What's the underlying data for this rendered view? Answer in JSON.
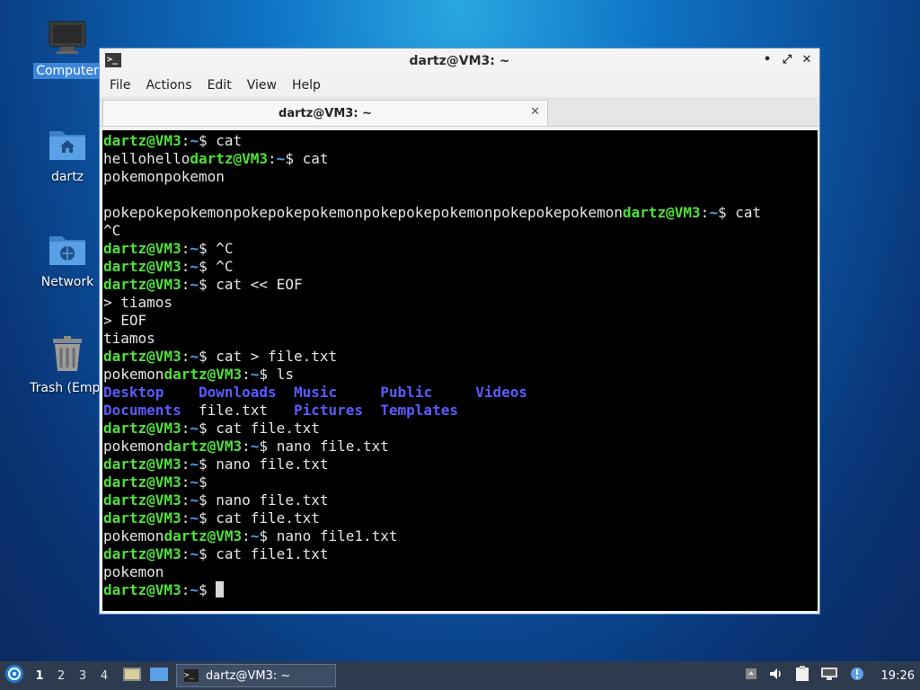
{
  "desktop": {
    "icons": [
      {
        "name": "Computer"
      },
      {
        "name": "dartz"
      },
      {
        "name": "Network"
      },
      {
        "name": "Trash (Empt"
      }
    ]
  },
  "window": {
    "title": "dartz@VM3: ~",
    "menu": [
      "File",
      "Actions",
      "Edit",
      "View",
      "Help"
    ],
    "tab_title": "dartz@VM3: ~",
    "controls": {
      "minimize": "•",
      "maximize": "⤢",
      "close": "✕"
    }
  },
  "terminal": {
    "lines": [
      [
        {
          "t": "dartz@VM3",
          "c": "user"
        },
        {
          "t": ":"
        },
        {
          "t": "~",
          "c": "path"
        },
        {
          "t": "$ cat"
        }
      ],
      [
        {
          "t": "hellohello"
        },
        {
          "t": "dartz@VM3",
          "c": "user"
        },
        {
          "t": ":"
        },
        {
          "t": "~",
          "c": "path"
        },
        {
          "t": "$ cat"
        }
      ],
      [
        {
          "t": "pokemonpokemon"
        }
      ],
      [
        {
          "t": ""
        }
      ],
      [
        {
          "t": "pokepokepokemonpokepokepokemonpokepokepokemonpokepokepokemon"
        },
        {
          "t": "dartz@VM3",
          "c": "user"
        },
        {
          "t": ":"
        },
        {
          "t": "~",
          "c": "path"
        },
        {
          "t": "$ cat"
        }
      ],
      [
        {
          "t": "^C"
        }
      ],
      [
        {
          "t": "dartz@VM3",
          "c": "user"
        },
        {
          "t": ":"
        },
        {
          "t": "~",
          "c": "path"
        },
        {
          "t": "$ ^C"
        }
      ],
      [
        {
          "t": "dartz@VM3",
          "c": "user"
        },
        {
          "t": ":"
        },
        {
          "t": "~",
          "c": "path"
        },
        {
          "t": "$ ^C"
        }
      ],
      [
        {
          "t": "dartz@VM3",
          "c": "user"
        },
        {
          "t": ":"
        },
        {
          "t": "~",
          "c": "path"
        },
        {
          "t": "$ cat << EOF"
        }
      ],
      [
        {
          "t": "> tiamos"
        }
      ],
      [
        {
          "t": "> EOF"
        }
      ],
      [
        {
          "t": "tiamos"
        }
      ],
      [
        {
          "t": "dartz@VM3",
          "c": "user"
        },
        {
          "t": ":"
        },
        {
          "t": "~",
          "c": "path"
        },
        {
          "t": "$ cat > file.txt"
        }
      ],
      [
        {
          "t": "pokemon"
        },
        {
          "t": "dartz@VM3",
          "c": "user"
        },
        {
          "t": ":"
        },
        {
          "t": "~",
          "c": "path"
        },
        {
          "t": "$ ls"
        }
      ],
      [
        {
          "t": "Desktop",
          "c": "dir"
        },
        {
          "t": "    "
        },
        {
          "t": "Downloads",
          "c": "dir"
        },
        {
          "t": "  "
        },
        {
          "t": "Music",
          "c": "dir"
        },
        {
          "t": "     "
        },
        {
          "t": "Public",
          "c": "dir"
        },
        {
          "t": "     "
        },
        {
          "t": "Videos",
          "c": "dir"
        }
      ],
      [
        {
          "t": "Documents",
          "c": "dir"
        },
        {
          "t": "  file.txt   "
        },
        {
          "t": "Pictures",
          "c": "dir"
        },
        {
          "t": "  "
        },
        {
          "t": "Templates",
          "c": "dir"
        }
      ],
      [
        {
          "t": "dartz@VM3",
          "c": "user"
        },
        {
          "t": ":"
        },
        {
          "t": "~",
          "c": "path"
        },
        {
          "t": "$ cat file.txt"
        }
      ],
      [
        {
          "t": "pokemon"
        },
        {
          "t": "dartz@VM3",
          "c": "user"
        },
        {
          "t": ":"
        },
        {
          "t": "~",
          "c": "path"
        },
        {
          "t": "$ nano file.txt"
        }
      ],
      [
        {
          "t": "dartz@VM3",
          "c": "user"
        },
        {
          "t": ":"
        },
        {
          "t": "~",
          "c": "path"
        },
        {
          "t": "$ nano file.txt"
        }
      ],
      [
        {
          "t": "dartz@VM3",
          "c": "user"
        },
        {
          "t": ":"
        },
        {
          "t": "~",
          "c": "path"
        },
        {
          "t": "$"
        }
      ],
      [
        {
          "t": "dartz@VM3",
          "c": "user"
        },
        {
          "t": ":"
        },
        {
          "t": "~",
          "c": "path"
        },
        {
          "t": "$ nano file.txt"
        }
      ],
      [
        {
          "t": "dartz@VM3",
          "c": "user"
        },
        {
          "t": ":"
        },
        {
          "t": "~",
          "c": "path"
        },
        {
          "t": "$ cat file.txt"
        }
      ],
      [
        {
          "t": "pokemon"
        },
        {
          "t": "dartz@VM3",
          "c": "user"
        },
        {
          "t": ":"
        },
        {
          "t": "~",
          "c": "path"
        },
        {
          "t": "$ nano file1.txt"
        }
      ],
      [
        {
          "t": "dartz@VM3",
          "c": "user"
        },
        {
          "t": ":"
        },
        {
          "t": "~",
          "c": "path"
        },
        {
          "t": "$ cat file1.txt"
        }
      ],
      [
        {
          "t": "pokemon"
        }
      ],
      [
        {
          "t": "dartz@VM3",
          "c": "user"
        },
        {
          "t": ":"
        },
        {
          "t": "~",
          "c": "path"
        },
        {
          "t": "$ "
        },
        {
          "cursor": true
        }
      ]
    ]
  },
  "taskbar": {
    "workspaces": [
      "1",
      "2",
      "3",
      "4"
    ],
    "task_label": "dartz@VM3: ~",
    "clock": "19:26"
  },
  "colors": {
    "prompt_user": "#4fe039",
    "prompt_path": "#4aa3f0",
    "directory": "#5b5bff",
    "taskbar": "#2e3b4e"
  }
}
